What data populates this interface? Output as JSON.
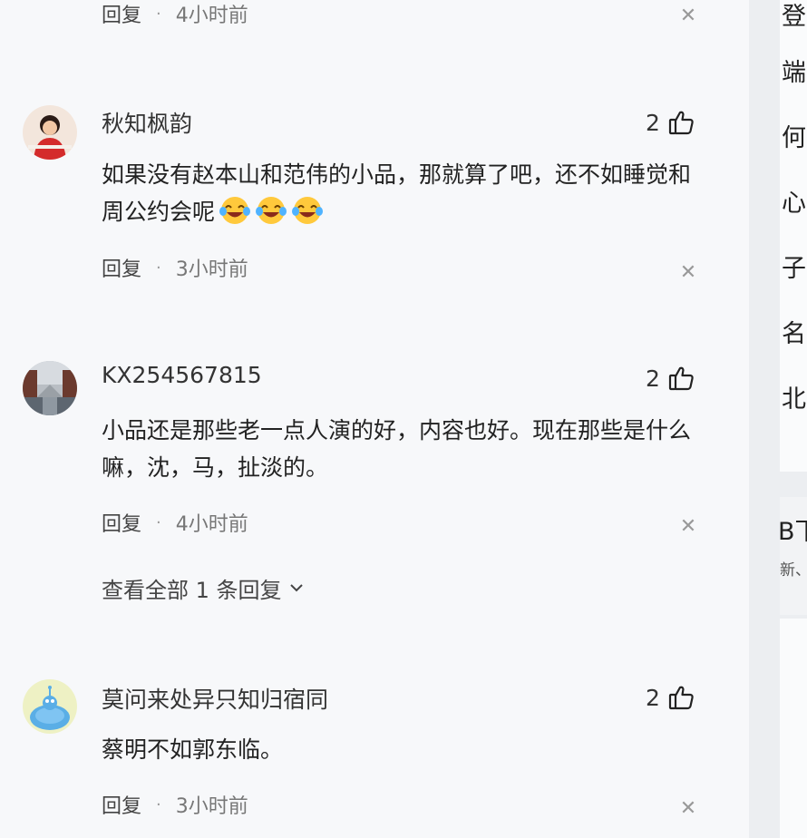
{
  "comments": [
    {
      "reply_label": "回复",
      "time": "4小时前"
    },
    {
      "username": "秋知枫韵",
      "likes": "2",
      "content": "如果没有赵本山和范伟的小品，那就算了吧，还不如睡觉和周公约会呢",
      "emojis": [
        "laughing-crying-emoji",
        "laughing-crying-emoji",
        "laughing-crying-emoji"
      ],
      "reply_label": "回复",
      "time": "3小时前"
    },
    {
      "username": "KX254567815",
      "likes": "2",
      "content": "小品还是那些老一点人演的好，内容也好。现在那些是什么嘛，沈，马，扯淡的。",
      "reply_label": "回复",
      "time": "4小时前",
      "view_all_replies": "查看全部 1 条回复"
    },
    {
      "username": "莫问来处异只知归宿同",
      "likes": "2",
      "content": "蔡明不如郭东临。",
      "reply_label": "回复",
      "time": "3小时前"
    }
  ],
  "sidebar": {
    "chars": [
      "登",
      "端",
      "何",
      "心",
      "子",
      "名",
      "北"
    ],
    "mid_title": "B下",
    "mid_sub": "新、"
  },
  "icons": {
    "like": "thumbs-up-icon",
    "close": "close-icon",
    "expand": "chevron-down-icon"
  }
}
